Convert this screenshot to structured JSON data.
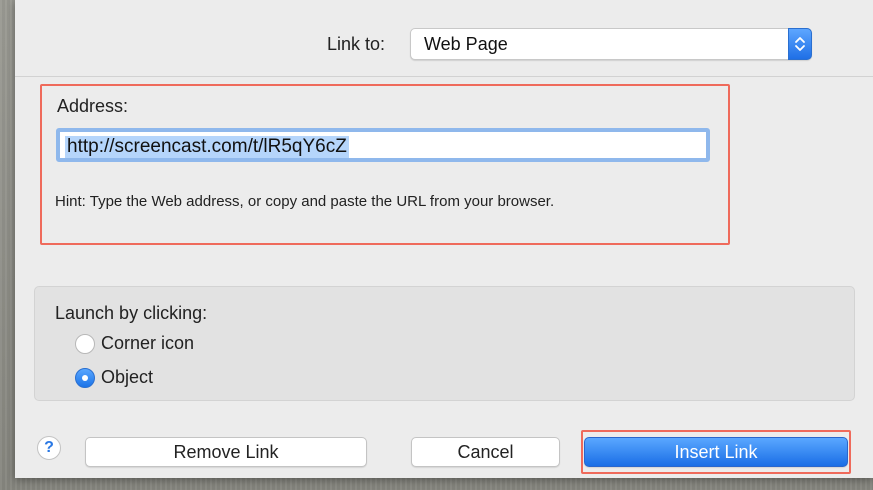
{
  "link_to": {
    "label": "Link to:",
    "selected": "Web Page"
  },
  "address": {
    "label": "Address:",
    "value": "http://screencast.com/t/lR5qY6cZ",
    "hint": "Hint: Type the Web address, or copy and paste the URL from your browser."
  },
  "launch": {
    "label": "Launch by clicking:",
    "options": [
      {
        "label": "Corner icon",
        "selected": false
      },
      {
        "label": "Object",
        "selected": true
      }
    ]
  },
  "buttons": {
    "help": "?",
    "remove": "Remove Link",
    "cancel": "Cancel",
    "insert": "Insert Link"
  },
  "colors": {
    "accent": "#1a6ee6",
    "highlight_outline": "#ef6a5b",
    "selection": "#b5d5fb"
  },
  "icons": {
    "popup_arrows": "chevron-up-down-icon",
    "help": "help-icon"
  }
}
